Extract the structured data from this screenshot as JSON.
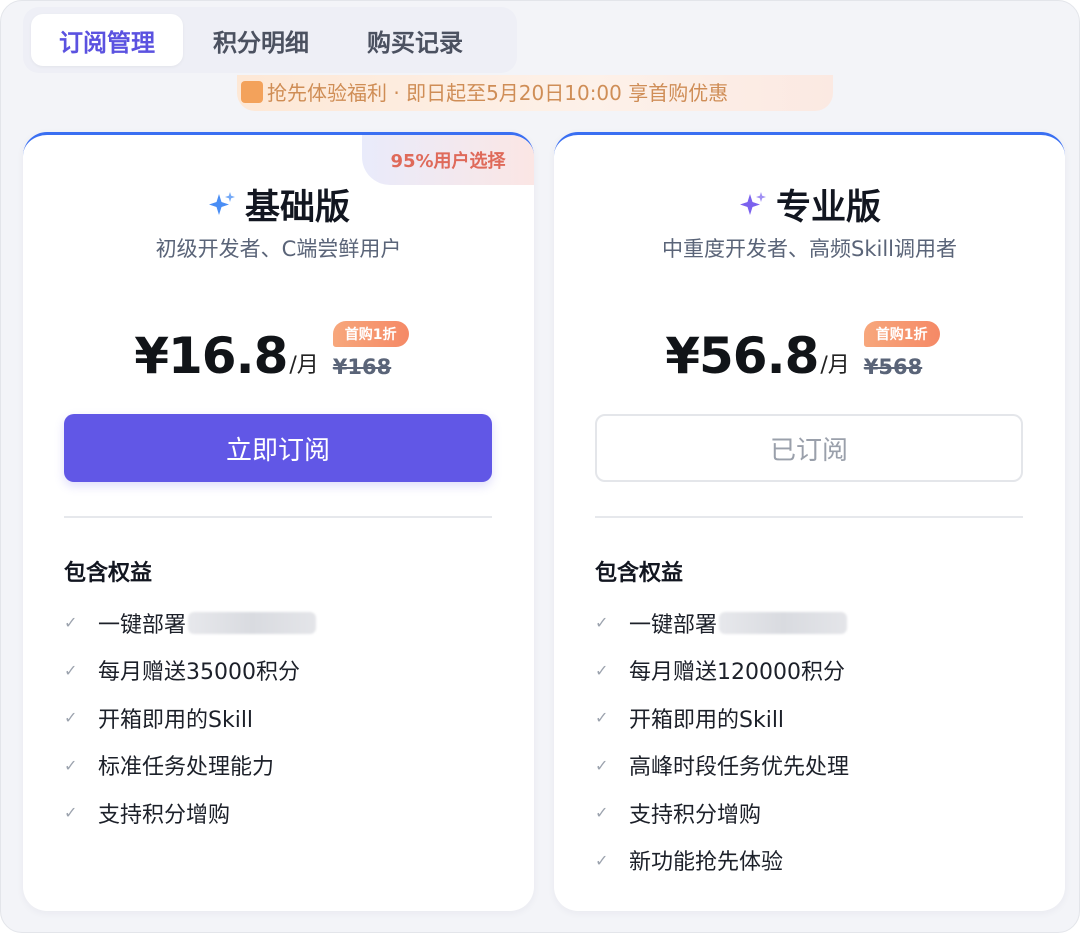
{
  "tabs": [
    {
      "label": "订阅管理",
      "active": true
    },
    {
      "label": "积分明细",
      "active": false
    },
    {
      "label": "购买记录",
      "active": false
    }
  ],
  "promo": {
    "text": "抢先体验福利 · 即日起至5月20日10:00 享首购优惠"
  },
  "colors": {
    "accent": "#6157e6",
    "top_border": "#3a6ff2",
    "badge": "#f58966"
  },
  "plans": [
    {
      "ribbon": "95%用户选择",
      "icon": "sparkle-blue-icon",
      "title": "基础版",
      "subtitle": "初级开发者、C端尝鲜用户",
      "price": "¥16.8",
      "per": "/月",
      "discount_badge": "首购1折",
      "original_price": "¥168",
      "button": "立即订阅",
      "button_state": "active",
      "benefits_title": "包含权益",
      "benefits": [
        "一键部署",
        "每月赠送35000积分",
        "开箱即用的Skill",
        "标准任务处理能力",
        "支持积分增购"
      ]
    },
    {
      "icon": "sparkle-purple-icon",
      "title": "专业版",
      "subtitle": "中重度开发者、高频Skill调用者",
      "price": "¥56.8",
      "per": "/月",
      "discount_badge": "首购1折",
      "original_price": "¥568",
      "button": "已订阅",
      "button_state": "disabled",
      "benefits_title": "包含权益",
      "benefits": [
        "一键部署",
        "每月赠送120000积分",
        "开箱即用的Skill",
        "高峰时段任务优先处理",
        "支持积分增购",
        "新功能抢先体验"
      ]
    }
  ]
}
